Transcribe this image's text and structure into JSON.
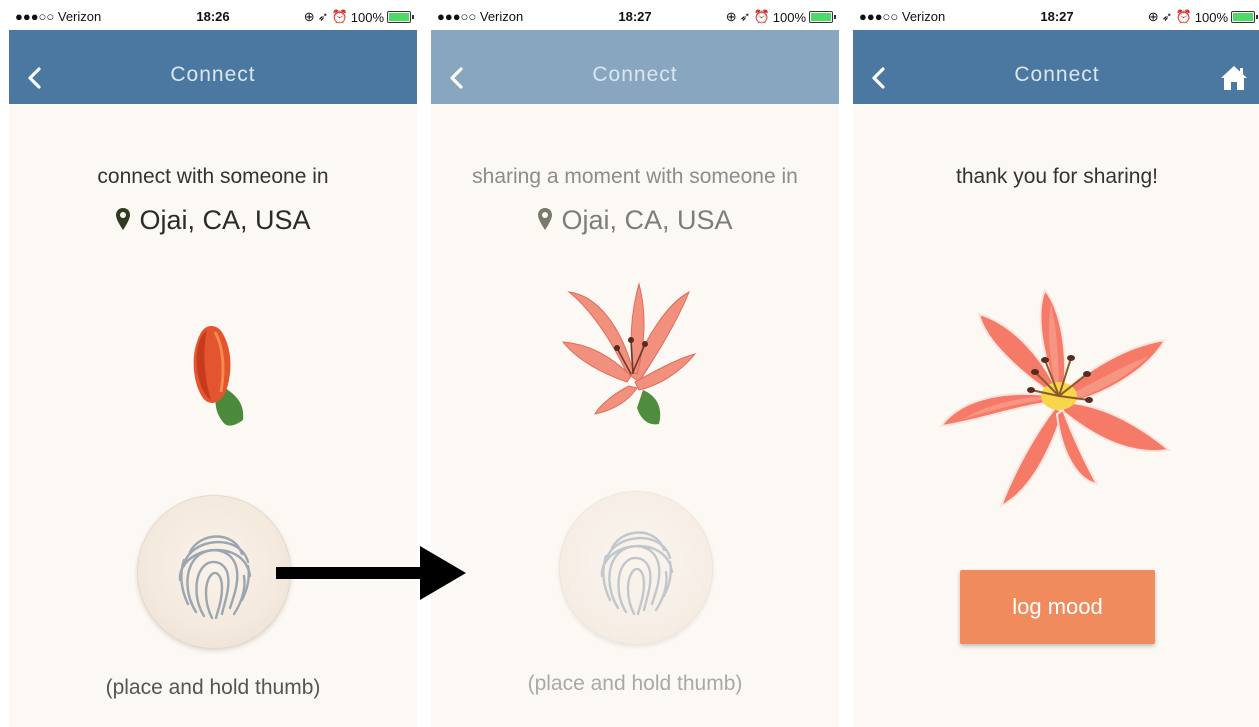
{
  "status": {
    "carrier": "●●●○○ Verizon",
    "battery": "100%",
    "times": [
      "18:26",
      "18:27",
      "18:27"
    ]
  },
  "nav": {
    "title": "Connect"
  },
  "screen1": {
    "prompt": "connect with someone in",
    "location": "Ojai, CA, USA",
    "hint": "(place and hold thumb)"
  },
  "screen2": {
    "prompt": "sharing a moment with someone in",
    "location": "Ojai, CA, USA",
    "hint": "(place and hold thumb)"
  },
  "screen3": {
    "message": "thank you for sharing!",
    "button": "log mood"
  },
  "colors": {
    "navbar": "#4b78a0",
    "navbar_faded": "#88a6c0",
    "button": "#ef8b5d",
    "background": "#fcf9f5"
  }
}
